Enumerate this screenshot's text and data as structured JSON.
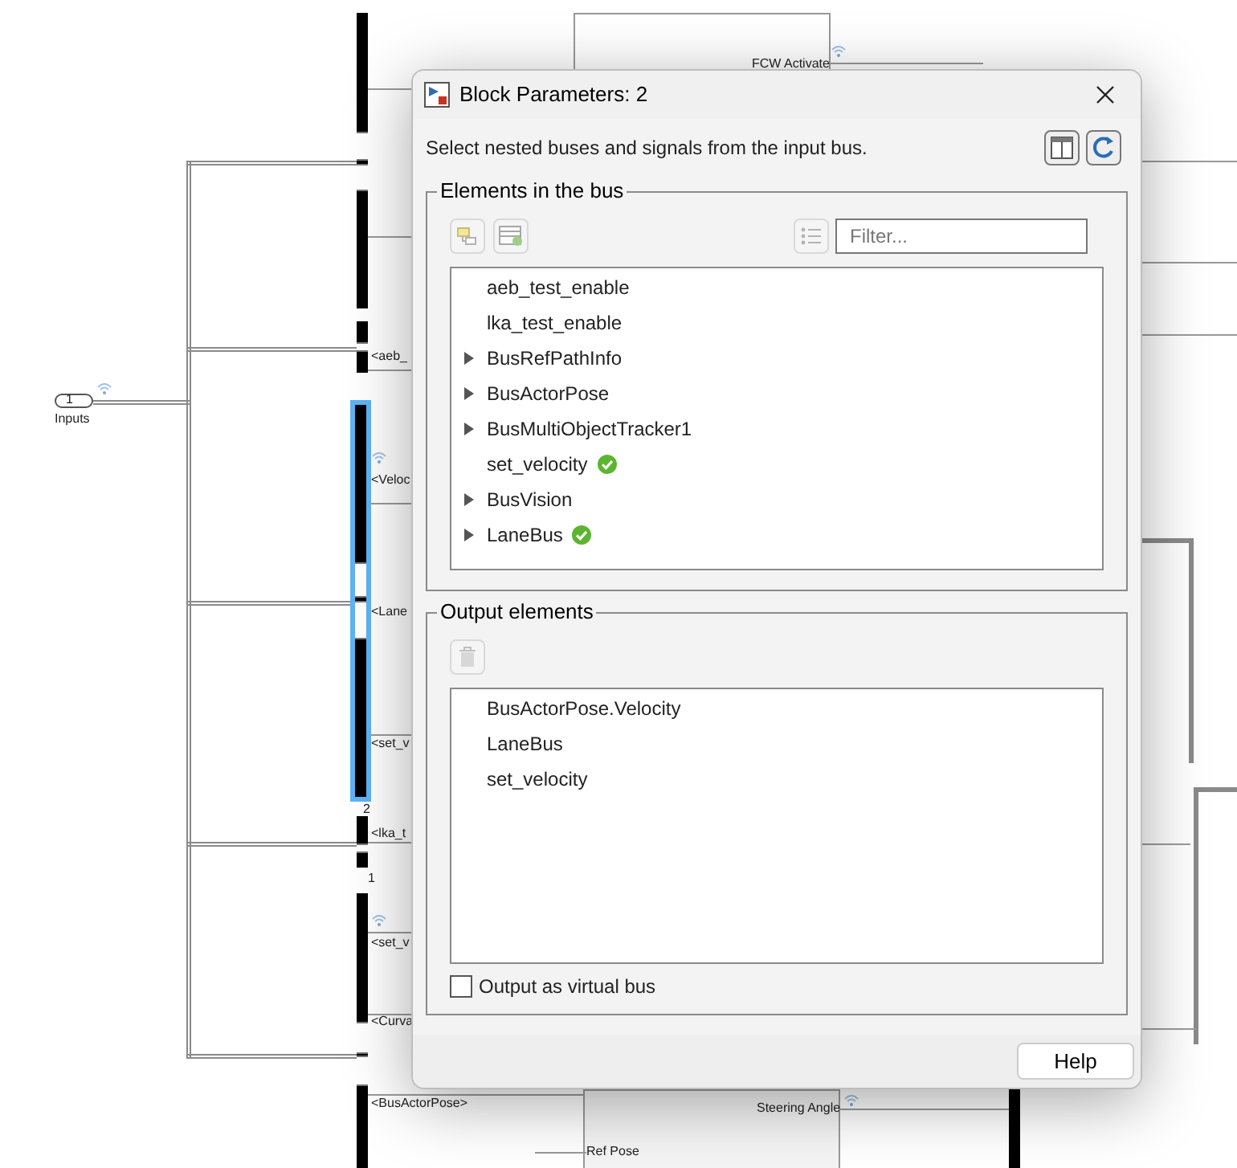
{
  "canvas": {
    "labels": [
      {
        "text": "FCW Activate"
      },
      {
        "text": "1"
      },
      {
        "text": "Inputs"
      },
      {
        "text": "<aeb_"
      },
      {
        "text": "<Veloc"
      },
      {
        "text": "<Lane"
      },
      {
        "text": "<set_v"
      },
      {
        "text": "2"
      },
      {
        "text": "<lka_t"
      },
      {
        "text": "1"
      },
      {
        "text": "<set_v"
      },
      {
        "text": "<Curva"
      },
      {
        "text": "<BusActorPose>"
      },
      {
        "text": "Steering Angle"
      },
      {
        "text": "Ref Pose"
      }
    ],
    "selected_block": {
      "selected": true
    }
  },
  "dialog": {
    "title": "Block Parameters: 2",
    "description": "Select nested buses and signals from the input bus.",
    "elements_group": {
      "title": "Elements in the bus",
      "filter": {
        "placeholder": "Filter..."
      },
      "items": [
        {
          "label": "aeb_test_enable",
          "kind": "signal",
          "added": false
        },
        {
          "label": "lka_test_enable",
          "kind": "signal",
          "added": false
        },
        {
          "label": "BusRefPathInfo",
          "kind": "bus",
          "added": false
        },
        {
          "label": "BusActorPose",
          "kind": "bus",
          "added": false
        },
        {
          "label": "BusMultiObjectTracker1",
          "kind": "bus",
          "added": false
        },
        {
          "label": "set_velocity",
          "kind": "signal",
          "added": true
        },
        {
          "label": "BusVision",
          "kind": "bus",
          "added": false
        },
        {
          "label": "LaneBus",
          "kind": "bus",
          "added": true
        }
      ]
    },
    "output_group": {
      "title": "Output elements",
      "items": [
        {
          "label": "BusActorPose.Velocity"
        },
        {
          "label": "LaneBus"
        },
        {
          "label": "set_velocity"
        }
      ]
    },
    "virtual_bus": {
      "label": "Output as virtual bus",
      "checked": false
    },
    "help_button": "Help"
  }
}
